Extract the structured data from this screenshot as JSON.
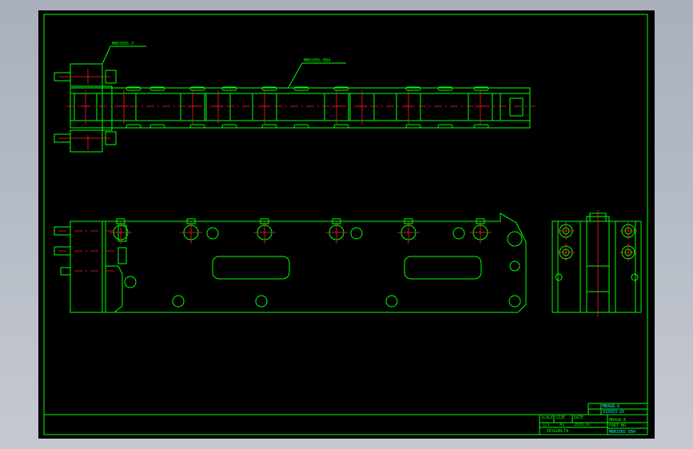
{
  "drawing": {
    "annotations": {
      "top_left_label": "MBR1ERS-3",
      "top_right_label": "MBR1ERS-EB4"
    },
    "title_block": {
      "scale_header": "SCALE",
      "size_header": "SIZE",
      "date_header": "DATE",
      "scale_value": "1/1",
      "size_value": "A1",
      "date_value": "2019.07",
      "company": "DEXGORLTA",
      "right_top_1": "MB4GB-8",
      "right_top_2": "MB4GB-8",
      "right_mid": "MB4GB-8",
      "part_no_header": "PART NO",
      "part_no": "MBR1ERS-EB4",
      "codes": "XXXXX3-XX"
    },
    "colors": {
      "lines": "#00ff00",
      "centerlines": "#ff2020",
      "background": "#000000"
    }
  }
}
